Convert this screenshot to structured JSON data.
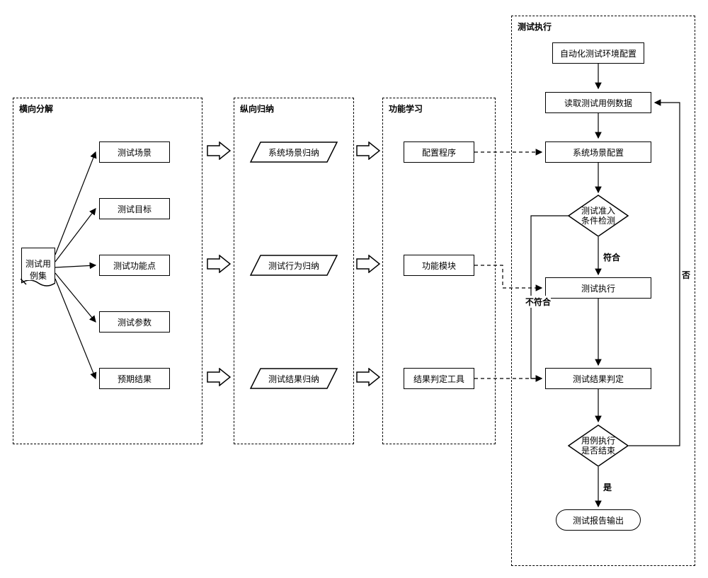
{
  "panels": {
    "p1": "横向分解",
    "p2": "纵向归纳",
    "p3": "功能学习",
    "p4": "测试执行"
  },
  "doc": "测试用\n例集",
  "decomp": {
    "n1": "测试场景",
    "n2": "测试目标",
    "n3": "测试功能点",
    "n4": "测试参数",
    "n5": "预期结果"
  },
  "induce": {
    "m1": "系统场景归纳",
    "m2": "测试行为归纳",
    "m3": "测试结果归纳"
  },
  "learn": {
    "f1": "配置程序",
    "f2": "功能模块",
    "f3": "结果判定工具"
  },
  "exec": {
    "e1": "自动化测试环境配置",
    "e2": "读取测试用例数据",
    "e3": "系统场景配置",
    "d1": "测试准入\n条件检测",
    "e4": "测试执行",
    "e5": "测试结果判定",
    "d2": "用例执行\n是否结束",
    "t1": "测试报告输出"
  },
  "labels": {
    "yes_meet": "符合",
    "no_meet": "不符合",
    "yes": "是",
    "no": "否"
  }
}
